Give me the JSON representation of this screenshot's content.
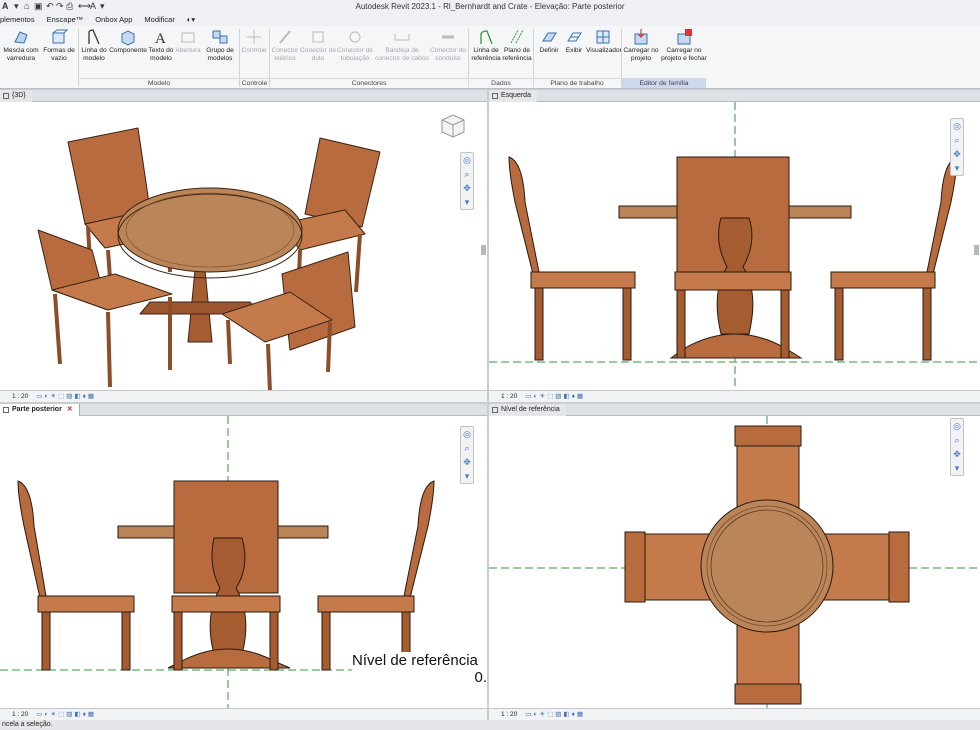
{
  "app": {
    "title": "Autodesk Revit 2023.1 - Rl_Bernhardt and Crate - Elevação: Parte posterior"
  },
  "menu": [
    "plementos",
    "Enscape™",
    "Onbox App",
    "Modificar"
  ],
  "ribbon": {
    "buttons": {
      "mescla": "Mescla com varredura",
      "formas": "Formas de vazio",
      "linha_modelo": "Linha do modelo",
      "componente": "Componente",
      "texto_modelo": "Texto do modelo",
      "abertura": "Abertura",
      "grupo_modelos": "Grupo de modelos",
      "controle": "Controle",
      "conector_eletrico": "Conector elétrico",
      "conector_duto": "Conector de duto",
      "conector_tubulacao": "Conector de tubulação",
      "bandeja": "Bandeja de conector de cabos",
      "conduite": "Conector do conduíte",
      "linha_referencia": "Linha de referência",
      "plano_referencia": "Plano de referência",
      "definir": "Definir",
      "exibir": "Exibir",
      "visualizador": "Visualizador",
      "carregar": "Carregar no projeto",
      "carregar_fechar": "Carregar no projeto e fechar"
    },
    "groups": {
      "modelo": "Modelo",
      "controle": "Controle",
      "conectores": "Conectores",
      "dados": "Dados",
      "plano": "Plano de trabalho",
      "editor": "Editor de família"
    }
  },
  "views": {
    "v3d": {
      "tab": "{3D}",
      "scale": "1 : 20"
    },
    "esquerda": {
      "tab": "Esquerda",
      "scale": "1 : 20"
    },
    "posterior": {
      "tab": "Parte posterior",
      "scale": "1 : 20",
      "level_label": "Nível de referência",
      "level_value": "0."
    },
    "nivel": {
      "tab": "Nível de referência",
      "scale": "1 : 20"
    }
  },
  "status": "ncela a seleção.",
  "colors": {
    "wood": "#b76b3e",
    "wood_dark": "#8c4d2a",
    "table_top": "#b98456",
    "ref_line": "#2f9a3a"
  }
}
